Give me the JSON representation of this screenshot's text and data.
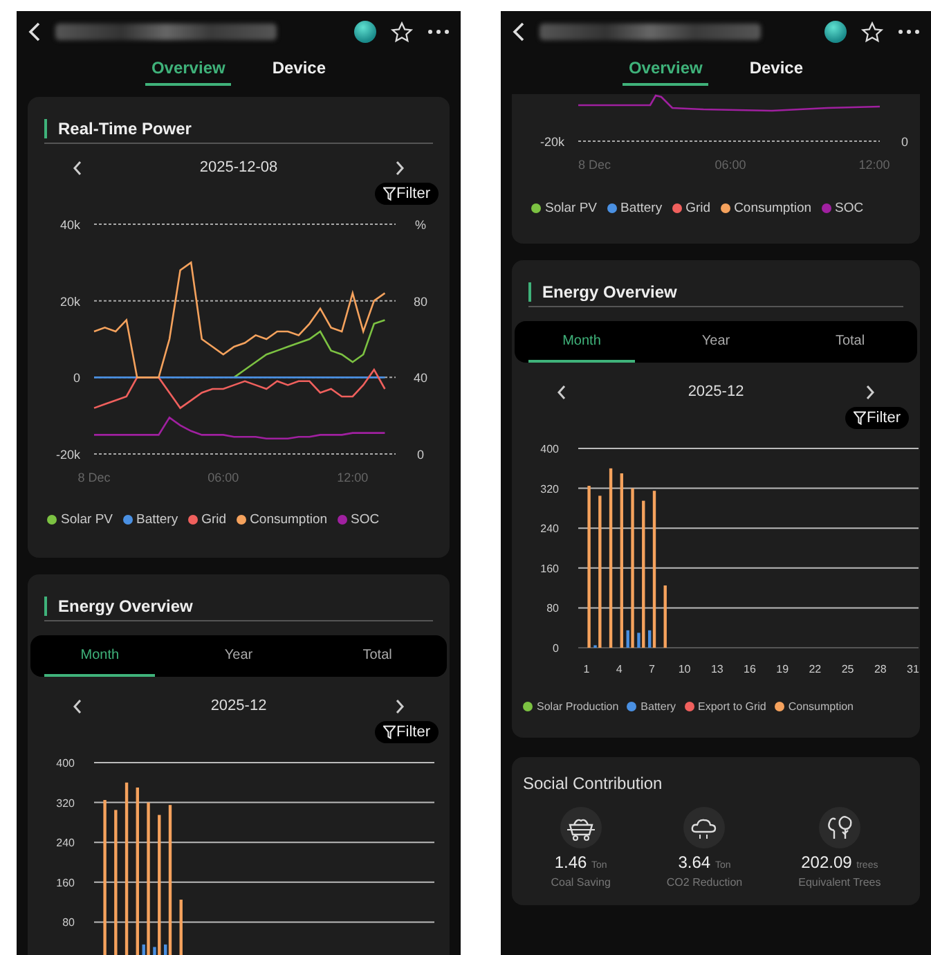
{
  "screens": [
    {
      "tabs": [
        {
          "label": "Overview",
          "selected": true
        },
        {
          "label": "Device",
          "selected": false
        }
      ],
      "sections": [
        {
          "kind": "realtime_power",
          "title": "Real-Time Power",
          "date": "2025-12-08",
          "filter": "Filter",
          "chart_data": {
            "type": "line",
            "x": [
              0,
              0.5,
              1,
              1.5,
              2,
              2.5,
              3,
              3.5,
              4,
              4.5,
              5,
              5.5,
              6,
              6.5,
              7,
              7.5,
              8,
              8.5,
              9,
              9.5,
              10,
              10.5,
              11,
              11.5,
              12,
              12.5,
              13,
              13.5
            ],
            "xlim": [
              0,
              14
            ],
            "ylim": [
              -20000,
              40000
            ],
            "yticks": [
              {
                "value": 40000,
                "label": "40k"
              },
              {
                "value": 20000,
                "label": "20k"
              },
              {
                "value": 0,
                "label": "0"
              },
              {
                "value": -20000,
                "label": "-20k"
              }
            ],
            "y2lim": [
              0,
              120
            ],
            "y2ticks": [
              {
                "value": 120,
                "label": "%"
              },
              {
                "value": 80,
                "label": "80"
              },
              {
                "value": 40,
                "label": "40"
              },
              {
                "value": 0,
                "label": "0"
              }
            ],
            "xticks": [
              {
                "value": 0,
                "label": "8 Dec"
              },
              {
                "value": 6,
                "label": "06:00"
              },
              {
                "value": 12,
                "label": "12:00"
              }
            ],
            "series": [
              {
                "name": "Solar PV",
                "color": "#7cc242",
                "values": [
                  null,
                  null,
                  null,
                  null,
                  null,
                  null,
                  null,
                  null,
                  null,
                  null,
                  null,
                  null,
                  null,
                  0,
                  2000,
                  4000,
                  6000,
                  7000,
                  8000,
                  9000,
                  10000,
                  12000,
                  7000,
                  6000,
                  4000,
                  6000,
                  14000,
                  15000
                ]
              },
              {
                "name": "Battery",
                "color": "#4a90e2",
                "values": [
                  0,
                  0,
                  0,
                  0,
                  0,
                  0,
                  0,
                  0,
                  0,
                  0,
                  0,
                  0,
                  0,
                  0,
                  0,
                  0,
                  0,
                  0,
                  0,
                  0,
                  0,
                  0,
                  0,
                  0,
                  0,
                  0,
                  0,
                  0
                ]
              },
              {
                "name": "Grid",
                "color": "#f0605d",
                "values": [
                  -8000,
                  -7000,
                  -6000,
                  -5000,
                  0,
                  0,
                  0,
                  -4000,
                  -8000,
                  -6000,
                  -4000,
                  -3000,
                  -3000,
                  -2000,
                  -1000,
                  -2000,
                  -3000,
                  -1000,
                  -2000,
                  -1000,
                  -1000,
                  -4000,
                  -3000,
                  -5000,
                  -5000,
                  -2000,
                  2000,
                  -3000
                ]
              },
              {
                "name": "Consumption",
                "color": "#f5a25d",
                "values": [
                  12000,
                  13000,
                  12000,
                  15000,
                  0,
                  0,
                  0,
                  10000,
                  28000,
                  30000,
                  10000,
                  8000,
                  6000,
                  8000,
                  9000,
                  11000,
                  10000,
                  12000,
                  12000,
                  11000,
                  14000,
                  18000,
                  13000,
                  12000,
                  22000,
                  12000,
                  20000,
                  22000
                ]
              },
              {
                "name": "SOC",
                "color": "#a020a0",
                "axis": "y2",
                "values": [
                  10,
                  10,
                  10,
                  10,
                  10,
                  10,
                  10,
                  19,
                  15,
                  12,
                  10,
                  10,
                  10,
                  9,
                  9,
                  9,
                  8,
                  8,
                  8,
                  9,
                  9,
                  10,
                  10,
                  10,
                  11,
                  11,
                  11,
                  11
                ]
              }
            ]
          }
        },
        {
          "kind": "energy_overview",
          "title": "Energy Overview",
          "periods": [
            {
              "label": "Month",
              "selected": true
            },
            {
              "label": "Year",
              "selected": false
            },
            {
              "label": "Total",
              "selected": false
            }
          ],
          "date": "2025-12",
          "filter": "Filter",
          "chart_data": {
            "type": "bar",
            "categories": [
              null,
              null,
              null,
              null,
              null,
              null,
              null,
              null,
              null,
              null,
              null,
              null,
              null,
              null,
              null,
              null,
              null,
              null,
              null,
              null,
              null,
              null,
              null,
              null,
              null,
              null,
              null,
              null,
              null,
              null,
              null
            ],
            "ylim": [
              0,
              400
            ],
            "yticks": [
              80,
              160,
              240,
              320,
              400
            ],
            "grid": true,
            "series": [
              {
                "color": "#4a90e2",
                "values": [
                  0,
                  null,
                  0,
                  0,
                  35,
                  30,
                  35,
                  0,
                  null,
                  null,
                  null,
                  null,
                  null,
                  null,
                  null,
                  null,
                  null,
                  null,
                  null,
                  null,
                  null,
                  null,
                  null,
                  null,
                  null,
                  null,
                  null,
                  null,
                  null,
                  null,
                  null
                ]
              },
              {
                "color": "#f5a25d",
                "values": [
                  325,
                  305,
                  360,
                  350,
                  320,
                  295,
                  315,
                  125,
                  null,
                  null,
                  null,
                  null,
                  null,
                  null,
                  null,
                  null,
                  null,
                  null,
                  null,
                  null,
                  null,
                  null,
                  null,
                  null,
                  null,
                  null,
                  null,
                  null,
                  null,
                  null,
                  null
                ]
              }
            ]
          }
        }
      ]
    },
    {
      "tabs": [
        {
          "label": "Overview",
          "selected": true
        },
        {
          "label": "Device",
          "selected": false
        }
      ],
      "sections": [
        {
          "kind": "power_tail",
          "y_label": "-20k",
          "y2_label": "0",
          "x_labels": [
            "8 Dec",
            "06:00",
            "12:00"
          ],
          "legend": [
            {
              "label": "Solar PV",
              "color": "#7cc242"
            },
            {
              "label": "Battery",
              "color": "#4a90e2"
            },
            {
              "label": "Grid",
              "color": "#f0605d"
            },
            {
              "label": "Consumption",
              "color": "#f5a25d"
            },
            {
              "label": "SOC",
              "color": "#a020a0"
            }
          ]
        },
        {
          "kind": "energy_overview",
          "title": "Energy Overview",
          "periods": [
            {
              "label": "Month",
              "selected": true
            },
            {
              "label": "Year",
              "selected": false
            },
            {
              "label": "Total",
              "selected": false
            }
          ],
          "date": "2025-12",
          "filter": "Filter",
          "chart_data": {
            "type": "bar",
            "x": [
              1,
              2,
              3,
              4,
              5,
              6,
              7,
              8
            ],
            "xlim": [
              1,
              31
            ],
            "ylim": [
              0,
              400
            ],
            "grid": true,
            "yticks": [
              0,
              80,
              160,
              240,
              320,
              400
            ],
            "xticks": [
              1,
              4,
              7,
              10,
              13,
              16,
              19,
              22,
              25,
              28,
              31
            ],
            "series": [
              {
                "color": "#4a90e2",
                "values": [
                  0,
                  5,
                  0,
                  0,
                  35,
                  30,
                  35,
                  0
                ]
              },
              {
                "color": "#f5a25d",
                "values": [
                  325,
                  305,
                  360,
                  350,
                  320,
                  295,
                  315,
                  125
                ]
              }
            ]
          },
          "legend": [
            {
              "label": "Solar Production",
              "color": "#7cc242"
            },
            {
              "label": "Battery",
              "color": "#4a90e2"
            },
            {
              "label": "Export to Grid",
              "color": "#f0605d"
            },
            {
              "label": "Consumption",
              "color": "#f5a25d"
            }
          ]
        },
        {
          "kind": "social",
          "title": "Social Contribution",
          "items": [
            {
              "kind": "coal",
              "value": "1.46",
              "unit": "Ton",
              "label": "Coal Saving"
            },
            {
              "kind": "co2",
              "value": "3.64",
              "unit": "Ton",
              "label": "CO2 Reduction"
            },
            {
              "kind": "trees",
              "value": "202.09",
              "unit": "trees",
              "label": "Equivalent Trees"
            }
          ]
        }
      ]
    }
  ]
}
